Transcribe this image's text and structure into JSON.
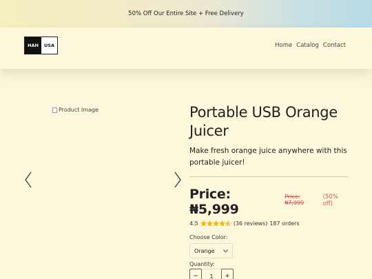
{
  "promo": {
    "text": "50% Off Our Entire Site + Free Delivery"
  },
  "header": {
    "logo": {
      "left": "HAH",
      "right": "USA"
    },
    "nav": [
      {
        "label": "Home"
      },
      {
        "label": "Catalog"
      },
      {
        "label": "Contact"
      }
    ]
  },
  "gallery": {
    "image_alt": "Product Image",
    "prev_icon": "chevron-left-icon",
    "next_icon": "chevron-right-icon"
  },
  "product": {
    "title": "Portable USB Orange Juicer",
    "description": "Make fresh orange juice anywhere with this portable juicer!",
    "price": "Price: ₦5,999",
    "old_price": "Price: ₦7,999",
    "discount": "(50% off)",
    "rating": "4.5",
    "stars_out_of_5": 4.5,
    "reviews": "(36 reviews)",
    "orders": "187 orders",
    "color_label": "Choose Color:",
    "color_value": "Orange",
    "quantity_label": "Quantity:",
    "quantity_value": "1",
    "minus": "−",
    "plus": "+"
  },
  "colors": {
    "background": "#fdf8dc",
    "discount_red": "#d9534f",
    "star_gold": "#f5b400"
  }
}
